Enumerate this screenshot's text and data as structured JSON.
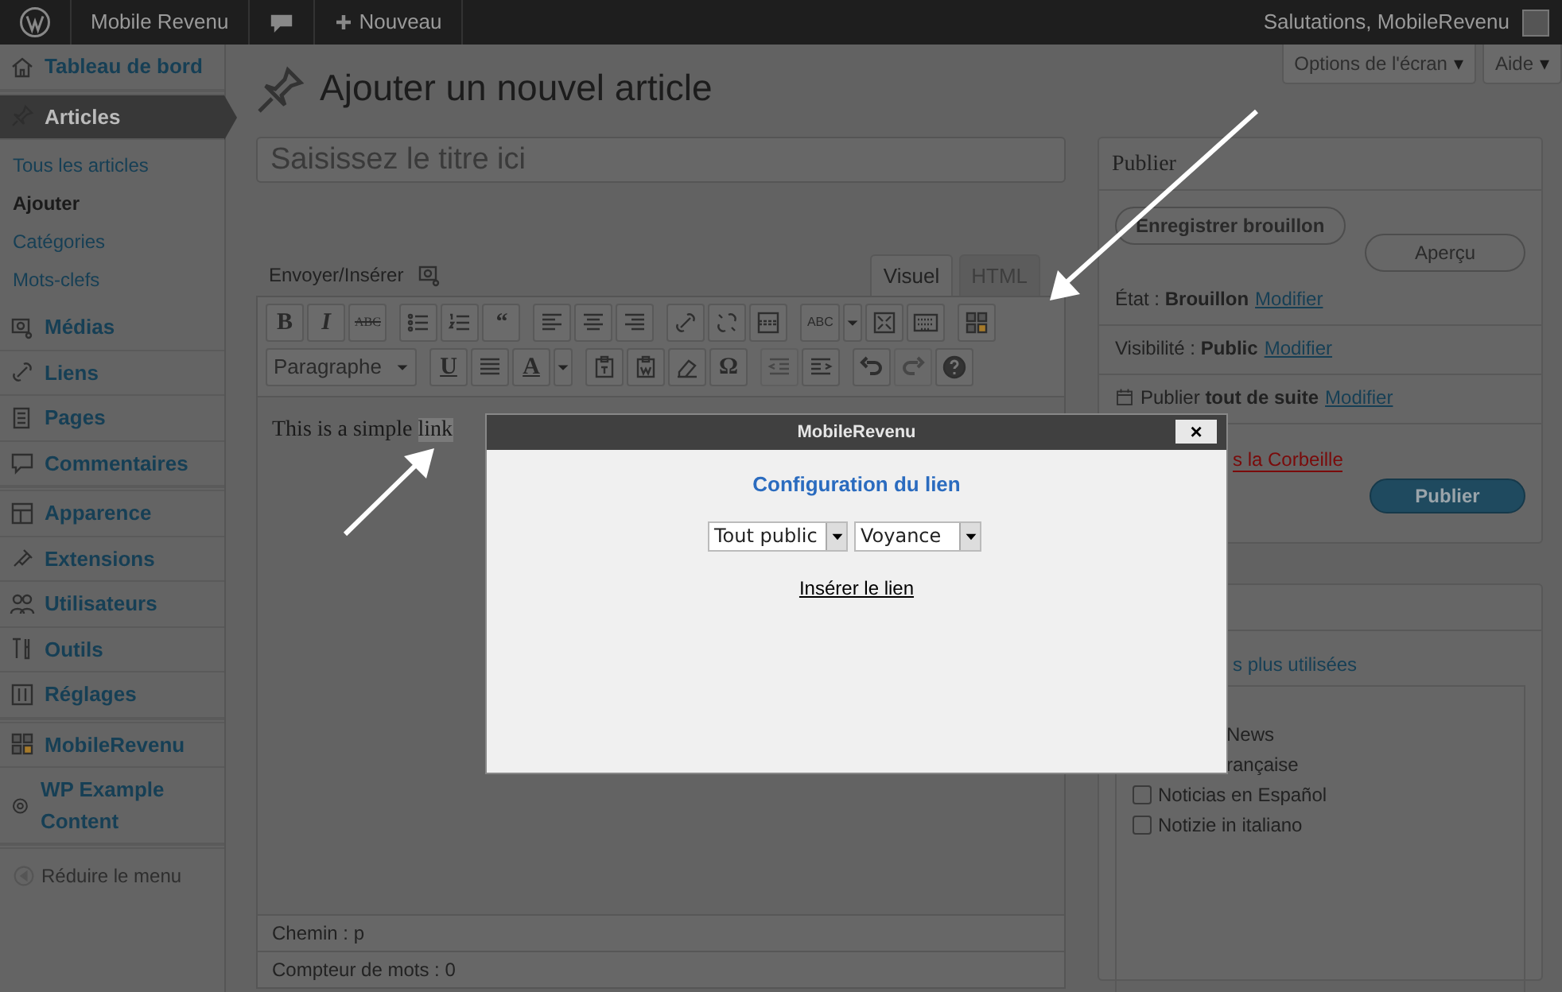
{
  "admin_bar": {
    "site": "Mobile Revenu",
    "new_label": "Nouveau",
    "greeting": "Salutations, MobileRevenu"
  },
  "screen_tabs": [
    {
      "label": "Options de l'écran",
      "caret": "▾"
    },
    {
      "label": "Aide",
      "caret": "▾"
    }
  ],
  "sidebar": {
    "groups": [
      [
        {
          "label": "Tableau de bord",
          "selected": false
        }
      ],
      [
        {
          "label": "Articles",
          "selected": true,
          "children": [
            {
              "label": "Tous les articles",
              "selected": false
            },
            {
              "label": "Ajouter",
              "selected": true
            },
            {
              "label": "Catégories",
              "selected": false
            },
            {
              "label": "Mots-clefs",
              "selected": false
            }
          ]
        },
        {
          "label": "Médias",
          "selected": false
        },
        {
          "label": "Liens",
          "selected": false
        },
        {
          "label": "Pages",
          "selected": false
        },
        {
          "label": "Commentaires",
          "selected": false
        }
      ],
      [
        {
          "label": "Apparence",
          "selected": false
        },
        {
          "label": "Extensions",
          "selected": false
        },
        {
          "label": "Utilisateurs",
          "selected": false
        },
        {
          "label": "Outils",
          "selected": false
        },
        {
          "label": "Réglages",
          "selected": false
        }
      ],
      [
        {
          "label": "MobileRevenu",
          "selected": false
        },
        {
          "label": "WP Example Content",
          "selected": false
        }
      ]
    ],
    "collapse": "Réduire le menu"
  },
  "page_title": "Ajouter un nouvel article",
  "title_field": {
    "placeholder": "Saisissez le titre ici"
  },
  "media_button": "Envoyer/Insérer",
  "editor_tabs": [
    {
      "label": "Visuel",
      "selected": true
    },
    {
      "label": "HTML",
      "selected": false
    }
  ],
  "toolbar_rows": [
    [
      [
        {
          "kind": "glyph",
          "text": "B",
          "disabled": false
        },
        {
          "kind": "glyph",
          "text": "I",
          "disabled": false
        },
        {
          "kind": "glyph",
          "text": "ABC",
          "disabled": false
        }
      ],
      [
        {
          "kind": "icon",
          "disabled": false
        },
        {
          "kind": "icon",
          "disabled": false
        },
        {
          "kind": "glyph",
          "text": "“",
          "disabled": false
        }
      ],
      [
        {
          "kind": "icon",
          "disabled": false
        },
        {
          "kind": "icon",
          "disabled": false
        },
        {
          "kind": "icon",
          "disabled": false
        }
      ],
      [
        {
          "kind": "icon",
          "disabled": false
        },
        {
          "kind": "icon",
          "disabled": false
        },
        {
          "kind": "icon",
          "disabled": false
        }
      ],
      [
        {
          "kind": "split",
          "text": "ABC",
          "disabled": false
        },
        {
          "kind": "icon",
          "disabled": false
        },
        {
          "kind": "icon",
          "disabled": false
        }
      ],
      [
        {
          "kind": "icon",
          "disabled": false
        }
      ]
    ],
    [
      [
        {
          "kind": "select",
          "text": "Paragraphe",
          "disabled": false
        }
      ],
      [
        {
          "kind": "glyph",
          "text": "U",
          "disabled": false
        },
        {
          "kind": "icon",
          "disabled": false
        },
        {
          "kind": "split",
          "text": "A",
          "disabled": false
        }
      ],
      [
        {
          "kind": "icon",
          "disabled": false
        },
        {
          "kind": "icon",
          "disabled": false
        },
        {
          "kind": "icon",
          "disabled": false
        },
        {
          "kind": "glyph",
          "text": "Ω",
          "disabled": false
        }
      ],
      [
        {
          "kind": "icon",
          "disabled": true
        },
        {
          "kind": "icon",
          "disabled": false
        }
      ],
      [
        {
          "kind": "icon",
          "disabled": false
        },
        {
          "kind": "icon",
          "disabled": true
        },
        {
          "kind": "icon",
          "disabled": false
        }
      ]
    ]
  ],
  "content": [
    {
      "text": "This is a simple ",
      "selected": false
    },
    {
      "text": "link",
      "selected": true
    }
  ],
  "status_path": "Chemin : p",
  "word_count": "Compteur de mots : 0",
  "publish_box": {
    "title": "Publier",
    "save_draft": "Enregistrer brouillon",
    "preview": "Aperçu",
    "rows": [
      {
        "kind": "status",
        "text": "État : **Brouillon**",
        "link": "Modifier"
      },
      {
        "kind": "status",
        "text": "Visibilité : **Public**",
        "link": "Modifier"
      },
      {
        "kind": "date",
        "text": "Publier **tout de suite**",
        "link": "Modifier"
      }
    ],
    "trash": "s la Corbeille",
    "publish": "Publier"
  },
  "categories_box": {
    "tab": "s plus utilisées",
    "items": [
      {
        "kind": "clipped",
        "label": "News"
      },
      {
        "kind": "clipped",
        "label": "rançaise"
      },
      {
        "kind": "checkbox",
        "label": "Noticias en Español",
        "checked": false
      },
      {
        "kind": "checkbox",
        "label": "Notizie in italiano",
        "checked": false
      }
    ]
  },
  "dialog": {
    "title": "MobileRevenu",
    "close": "×",
    "heading": "Configuration du lien",
    "selects": [
      "Tout public",
      "Voyance"
    ],
    "link": "Insérer le lien"
  }
}
